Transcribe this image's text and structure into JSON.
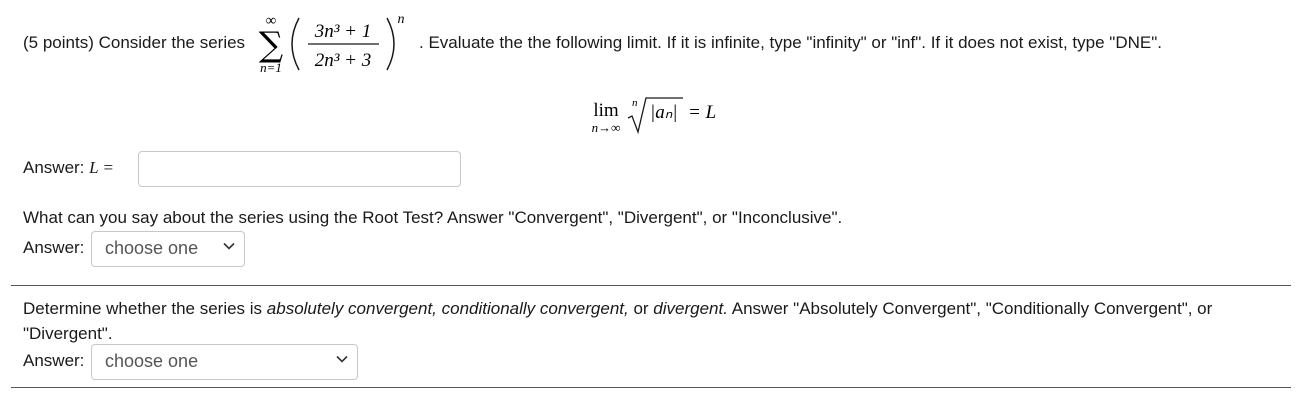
{
  "problem": {
    "intro": "(5 points) Consider the series",
    "instruction": ". Evaluate the the following limit. If it is infinite, type \"infinity\" or \"inf\". If it does not exist, type \"DNE\".",
    "series": {
      "upper": "∞",
      "lower": "n=1",
      "numerator": "3n³ + 1",
      "denominator": "2n³ + 3",
      "exponent": "n"
    },
    "limit_formula": {
      "lim": "lim",
      "sub": "n→∞",
      "root_index": "n",
      "radicand": "|aₙ|",
      "rhs": "= L"
    }
  },
  "answer_L": {
    "label": "Answer:",
    "var": "L =",
    "value": ""
  },
  "root_test": {
    "question": "What can you say about the series using the Root Test? Answer \"Convergent\", \"Divergent\", or \"Inconclusive\".",
    "label": "Answer:",
    "selected": "choose one"
  },
  "classification": {
    "q_prefix": "Determine whether the series is ",
    "q_em1": "absolutely convergent, conditionally convergent,",
    "q_mid": " or ",
    "q_em2": "divergent.",
    "q_suffix": " Answer \"Absolutely Convergent\", \"Conditionally Convergent\", or \"Divergent\".",
    "label": "Answer:",
    "selected": "choose one"
  }
}
